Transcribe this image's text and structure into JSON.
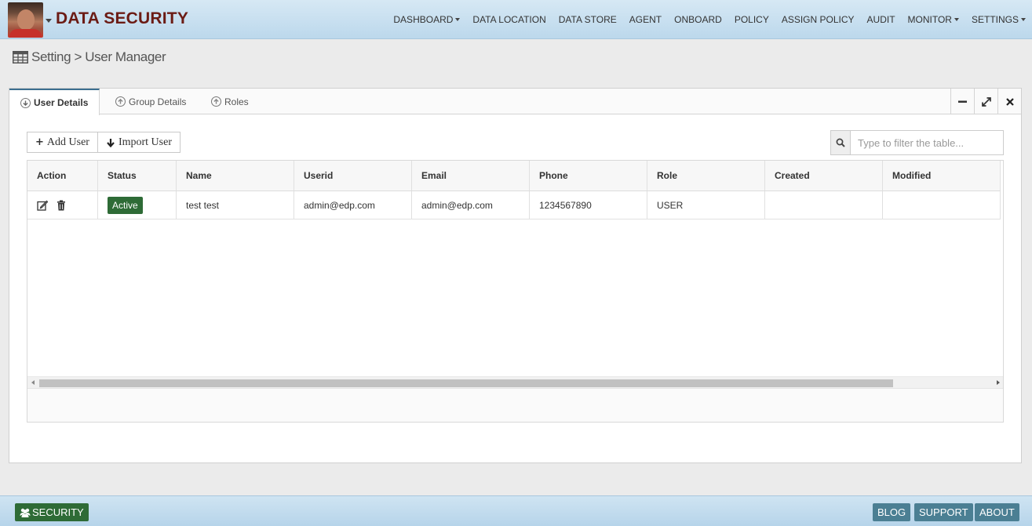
{
  "header": {
    "brand": "DATA SECURITY",
    "nav": [
      {
        "label": "DASHBOARD",
        "dropdown": true
      },
      {
        "label": "DATA LOCATION",
        "dropdown": false
      },
      {
        "label": "DATA STORE",
        "dropdown": false
      },
      {
        "label": "AGENT",
        "dropdown": false
      },
      {
        "label": "ONBOARD",
        "dropdown": false
      },
      {
        "label": "POLICY",
        "dropdown": false
      },
      {
        "label": "ASSIGN POLICY",
        "dropdown": false
      },
      {
        "label": "AUDIT",
        "dropdown": false
      },
      {
        "label": "MONITOR",
        "dropdown": true
      },
      {
        "label": "SETTINGS",
        "dropdown": true
      }
    ]
  },
  "breadcrumb": {
    "text": "Setting > User Manager",
    "icon": "table-icon"
  },
  "tabs": [
    {
      "label": "User Details",
      "icon": "circle-arrow-down-icon",
      "active": true
    },
    {
      "label": "Group Details",
      "icon": "circle-arrow-up-icon",
      "active": false
    },
    {
      "label": "Roles",
      "icon": "circle-arrow-up-icon",
      "active": false
    }
  ],
  "panel_tools": [
    "minimize-icon",
    "expand-icon",
    "close-icon"
  ],
  "toolbar": {
    "add_user": "Add User",
    "import_user": "Import User",
    "filter_placeholder": "Type to filter the table..."
  },
  "table": {
    "columns": [
      "Action",
      "Status",
      "Name",
      "Userid",
      "Email",
      "Phone",
      "Role",
      "Created",
      "Modified"
    ],
    "rows": [
      {
        "status": "Active",
        "name": "test test",
        "userid": "admin@edp.com",
        "email": "admin@edp.com",
        "phone": "1234567890",
        "role": "USER",
        "created": "",
        "modified": ""
      }
    ]
  },
  "footer": {
    "left": "SECURITY",
    "right": [
      "BLOG",
      "SUPPORT",
      "ABOUT"
    ]
  },
  "colors": {
    "brand": "#6b1b14",
    "status_active": "#2e6b36",
    "footer_button": "#4b7f93"
  }
}
